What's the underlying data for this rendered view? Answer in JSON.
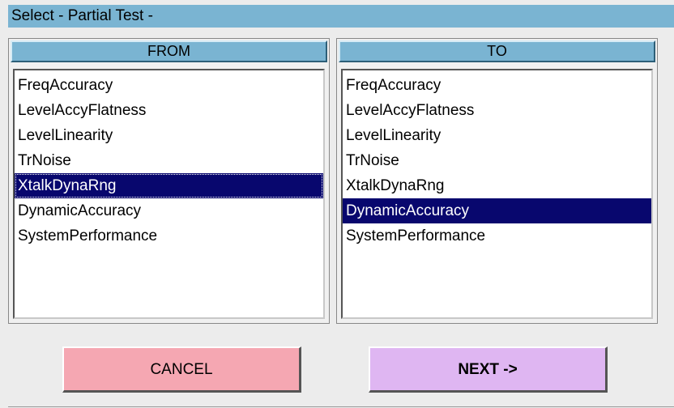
{
  "window": {
    "title": "Select - Partial Test -"
  },
  "from_panel": {
    "header": "FROM",
    "items": [
      "FreqAccuracy",
      "LevelAccyFlatness",
      "LevelLinearity",
      "TrNoise",
      "XtalkDynaRng",
      "DynamicAccuracy",
      "SystemPerformance"
    ],
    "selected": "XtalkDynaRng"
  },
  "to_panel": {
    "header": "TO",
    "items": [
      "FreqAccuracy",
      "LevelAccyFlatness",
      "LevelLinearity",
      "TrNoise",
      "XtalkDynaRng",
      "DynamicAccuracy",
      "SystemPerformance"
    ],
    "selected": "DynamicAccuracy"
  },
  "buttons": {
    "cancel_label": "CANCEL",
    "next_label": "NEXT ->"
  },
  "colors": {
    "header_bg": "#7ab4d2",
    "selection_bg": "#08076e",
    "cancel_bg": "#f5a7b2",
    "next_bg": "#dfb6f2"
  }
}
